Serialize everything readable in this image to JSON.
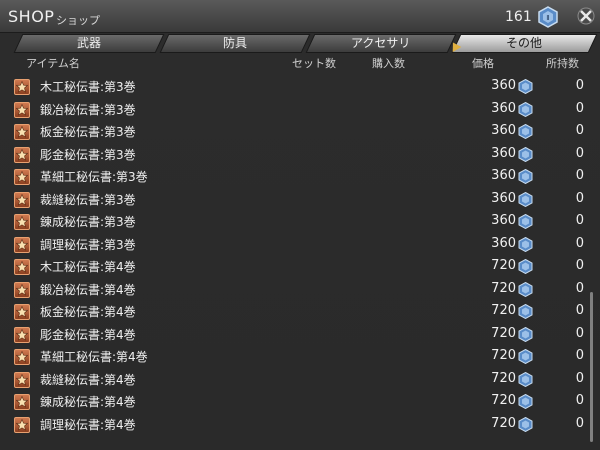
{
  "window": {
    "title": "SHOP",
    "subtitle": "ショップ"
  },
  "currency": {
    "amount": "161",
    "icon": "tomestone-icon"
  },
  "tabs": [
    {
      "label": "武器",
      "active": false
    },
    {
      "label": "防具",
      "active": false
    },
    {
      "label": "アクセサリ",
      "active": false
    },
    {
      "label": "その他",
      "active": true
    }
  ],
  "columns": {
    "item_name": "アイテム名",
    "set_count": "セット数",
    "purchase_count": "購入数",
    "price": "価格",
    "owned": "所持数"
  },
  "items": [
    {
      "name": "木工秘伝書:第3巻",
      "price": "360",
      "owned": "0"
    },
    {
      "name": "鍛冶秘伝書:第3巻",
      "price": "360",
      "owned": "0"
    },
    {
      "name": "板金秘伝書:第3巻",
      "price": "360",
      "owned": "0"
    },
    {
      "name": "彫金秘伝書:第3巻",
      "price": "360",
      "owned": "0"
    },
    {
      "name": "革細工秘伝書:第3巻",
      "price": "360",
      "owned": "0"
    },
    {
      "name": "裁縫秘伝書:第3巻",
      "price": "360",
      "owned": "0"
    },
    {
      "name": "錬成秘伝書:第3巻",
      "price": "360",
      "owned": "0"
    },
    {
      "name": "調理秘伝書:第3巻",
      "price": "360",
      "owned": "0"
    },
    {
      "name": "木工秘伝書:第4巻",
      "price": "720",
      "owned": "0"
    },
    {
      "name": "鍛冶秘伝書:第4巻",
      "price": "720",
      "owned": "0"
    },
    {
      "name": "板金秘伝書:第4巻",
      "price": "720",
      "owned": "0"
    },
    {
      "name": "彫金秘伝書:第4巻",
      "price": "720",
      "owned": "0"
    },
    {
      "name": "革細工秘伝書:第4巻",
      "price": "720",
      "owned": "0"
    },
    {
      "name": "裁縫秘伝書:第4巻",
      "price": "720",
      "owned": "0"
    },
    {
      "name": "錬成秘伝書:第4巻",
      "price": "720",
      "owned": "0"
    },
    {
      "name": "調理秘伝書:第4巻",
      "price": "720",
      "owned": "0"
    }
  ],
  "colors": {
    "accent": "#e0b040",
    "icon_fill": "#c06a40",
    "coin": "#6a9ad8"
  }
}
